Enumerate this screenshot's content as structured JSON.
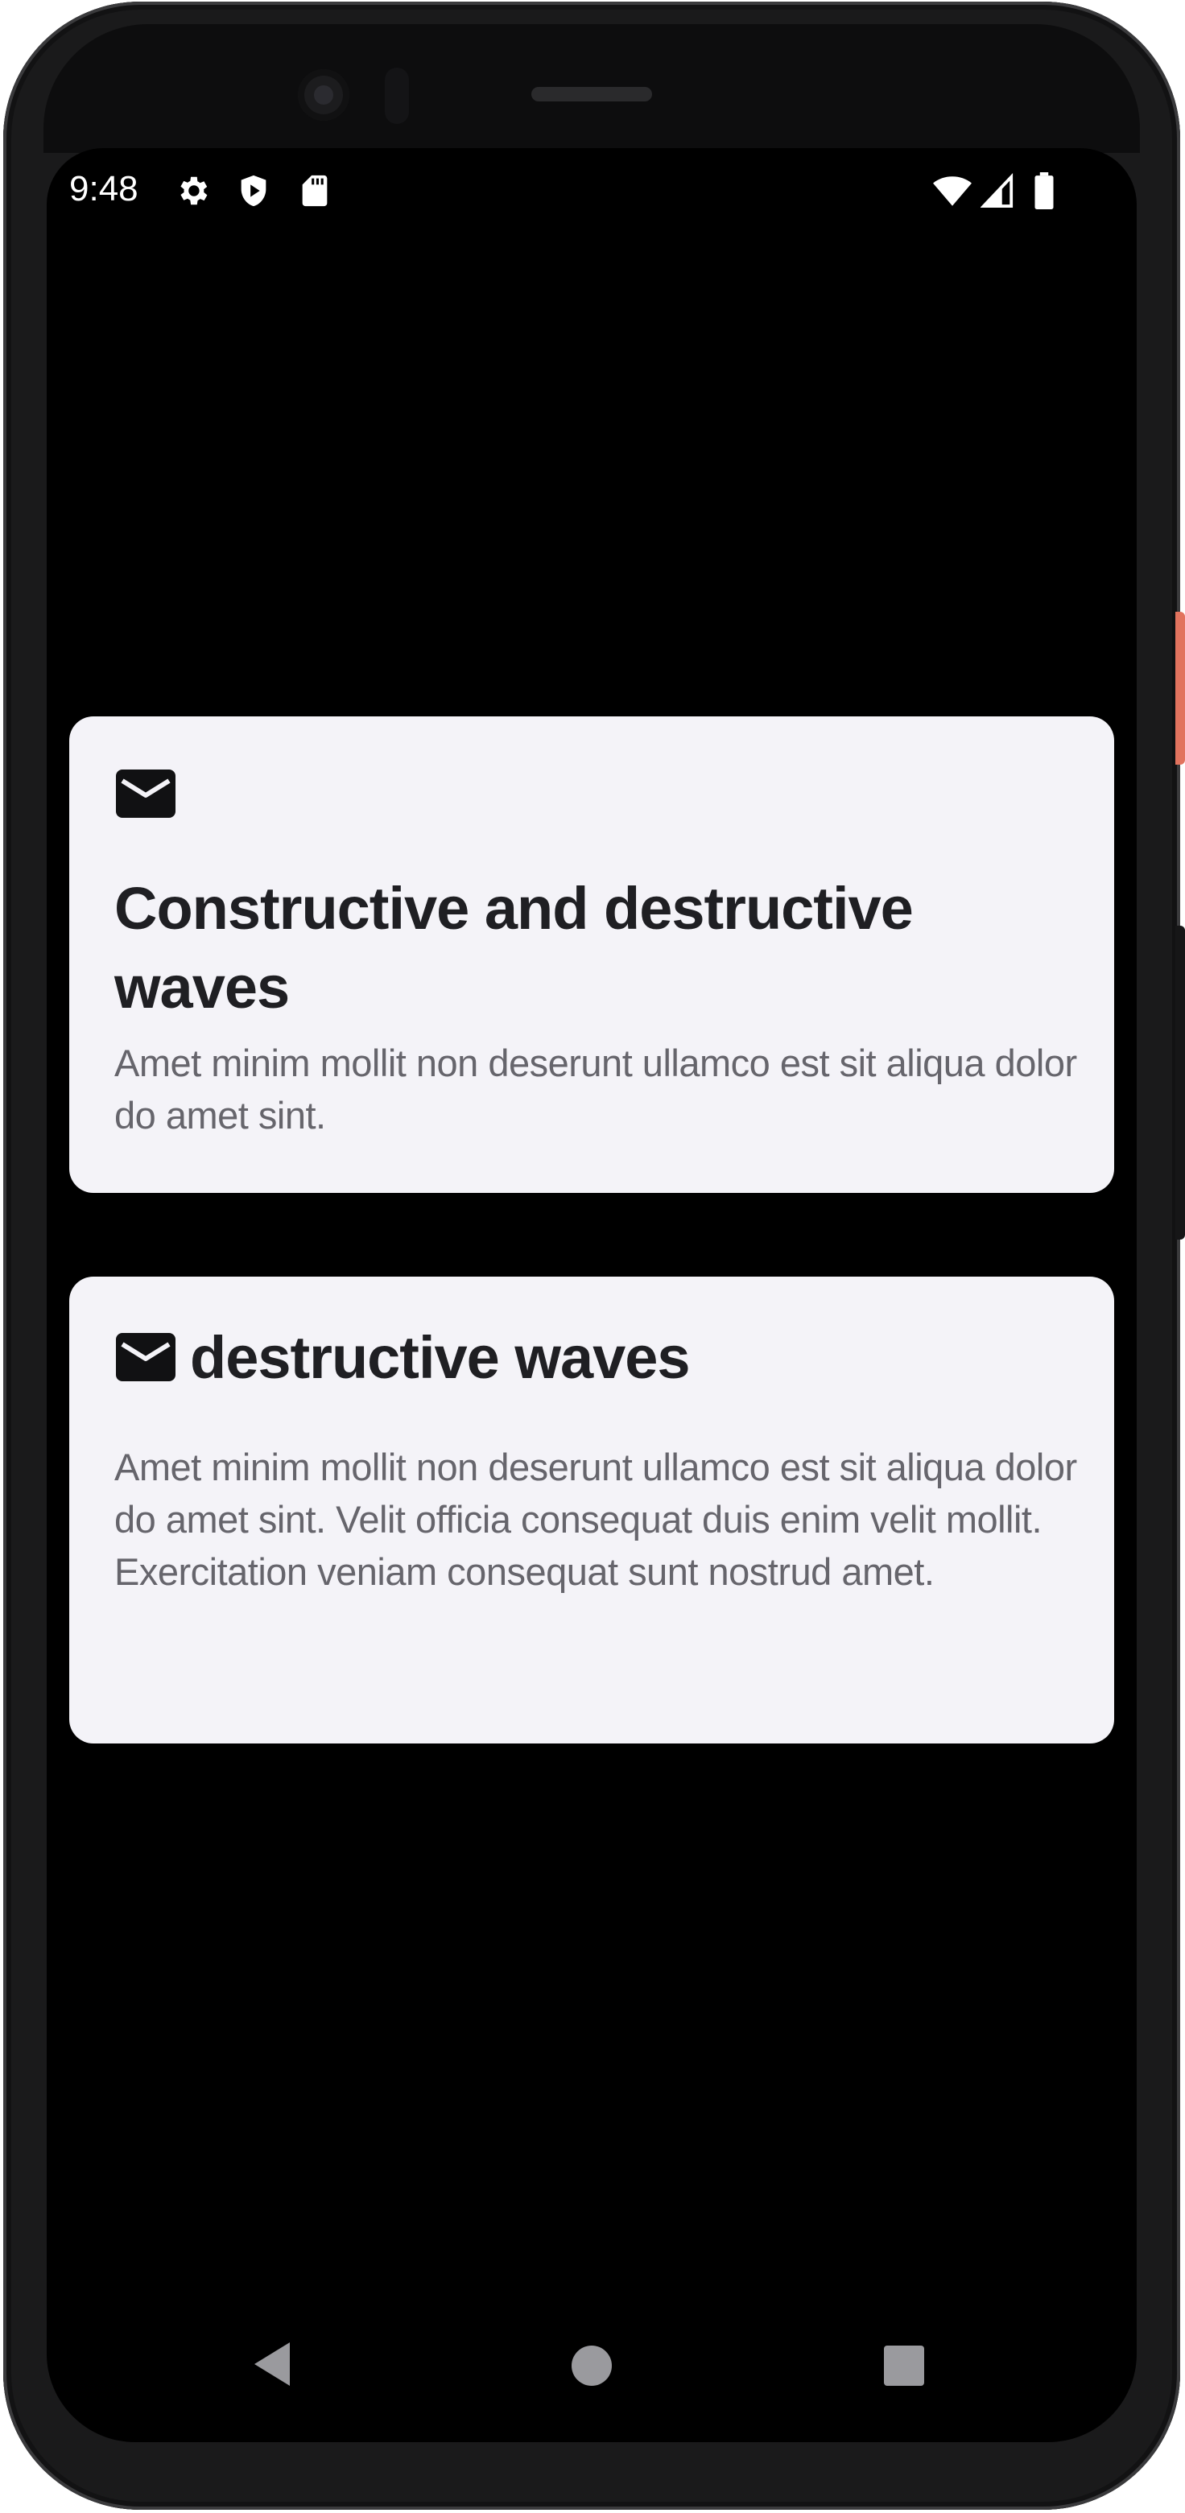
{
  "status_bar": {
    "time": "9:48",
    "left_icons": [
      "gear-icon",
      "shield-play-icon",
      "sd-card-icon"
    ],
    "right_icons": [
      "wifi-icon",
      "cell-signal-icon",
      "battery-icon"
    ]
  },
  "cards": [
    {
      "icon": "mail-icon",
      "title": "Constructive and destructive waves",
      "body": "Amet minim mollit non deserunt ullamco est sit aliqua dolor do amet sint."
    },
    {
      "icon": "mail-icon",
      "title": "destructive waves",
      "body": "Amet minim mollit non deserunt ullamco est sit aliqua dolor do amet sint. Velit officia consequat duis enim velit mollit. Exercitation veniam consequat sunt nostrud amet."
    }
  ],
  "nav_bar": {
    "buttons": [
      "back-icon",
      "home-icon",
      "recents-icon"
    ]
  },
  "colors": {
    "card_background": "#f4f3f8",
    "title_text": "#1f1f23",
    "body_text": "#66656c",
    "screen_background": "#000000"
  }
}
